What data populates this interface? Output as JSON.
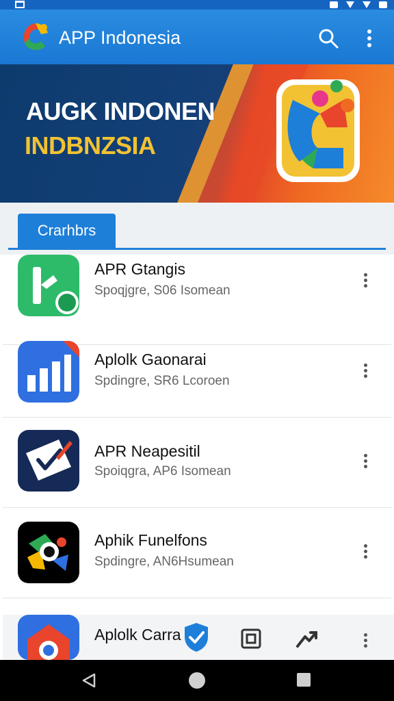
{
  "app_bar": {
    "title": "APP Indonesia",
    "icons": [
      "app-logo-icon",
      "search-icon",
      "more-vert-icon"
    ]
  },
  "banner": {
    "title": "AUGK INDONEN",
    "subtitle": "INDBNZSIA",
    "title_color": "#ffffff",
    "subtitle_color": "#f2c233"
  },
  "tabs": {
    "active_label": "Crarhbrs"
  },
  "apps": [
    {
      "title": "APR Gtangis",
      "subtitle": "Spoqjgre, S06 Isomean",
      "icon": "green-k-app-icon"
    },
    {
      "title": "Aplolk Gaonarai",
      "subtitle": "Spdingre, SR6 Lcoroen",
      "icon": "blue-chart-app-icon"
    },
    {
      "title": "APR Neapesitil",
      "subtitle": "Spoiqgra, AP6 Isomean",
      "icon": "checkbox-pen-app-icon"
    },
    {
      "title": "Aphik Funelfons",
      "subtitle": "Spdingre, AN6Hsumean",
      "icon": "colorful-camera-app-icon"
    },
    {
      "title": "Aplolk Carra",
      "subtitle": "",
      "icon": "chrome-like-app-icon"
    }
  ],
  "colors": {
    "primary": "#1e7fd8",
    "status_bar": "#1565c0"
  }
}
